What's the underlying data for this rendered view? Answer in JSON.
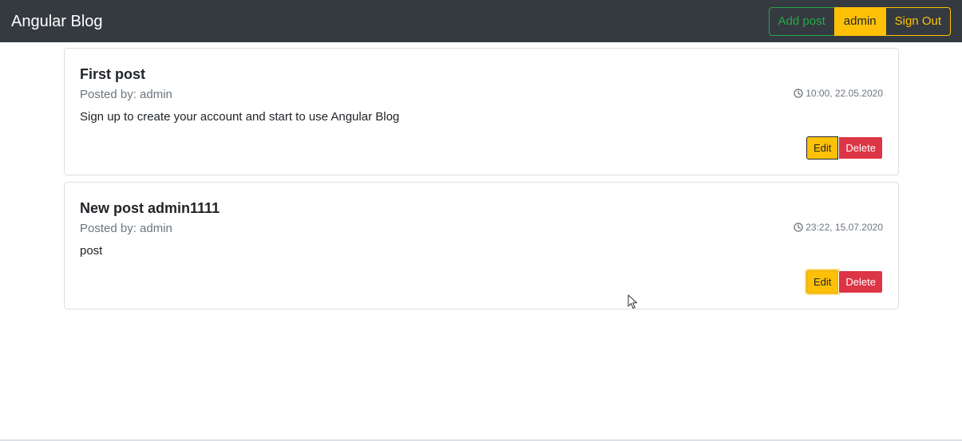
{
  "navbar": {
    "brand": "Angular Blog",
    "add_post_label": "Add post",
    "user_label": "admin",
    "sign_out_label": "Sign Out"
  },
  "posts": [
    {
      "title": "First post",
      "author": "Posted by: admin",
      "text": "Sign up to create your account and start to use Angular Blog",
      "date": "10:00, 22.05.2020",
      "edit_label": "Edit",
      "delete_label": "Delete"
    },
    {
      "title": "New post admin1111",
      "author": "Posted by: admin",
      "text": "post",
      "date": "23:22, 15.07.2020",
      "edit_label": "Edit",
      "delete_label": "Delete"
    }
  ],
  "icons": {
    "date": "clock-icon",
    "pointer": "mouse-cursor-icon"
  },
  "colors": {
    "navbar_bg": "#343a40",
    "success": "#28a745",
    "warning": "#ffc107",
    "danger": "#dc3545",
    "muted": "#6c757d"
  }
}
